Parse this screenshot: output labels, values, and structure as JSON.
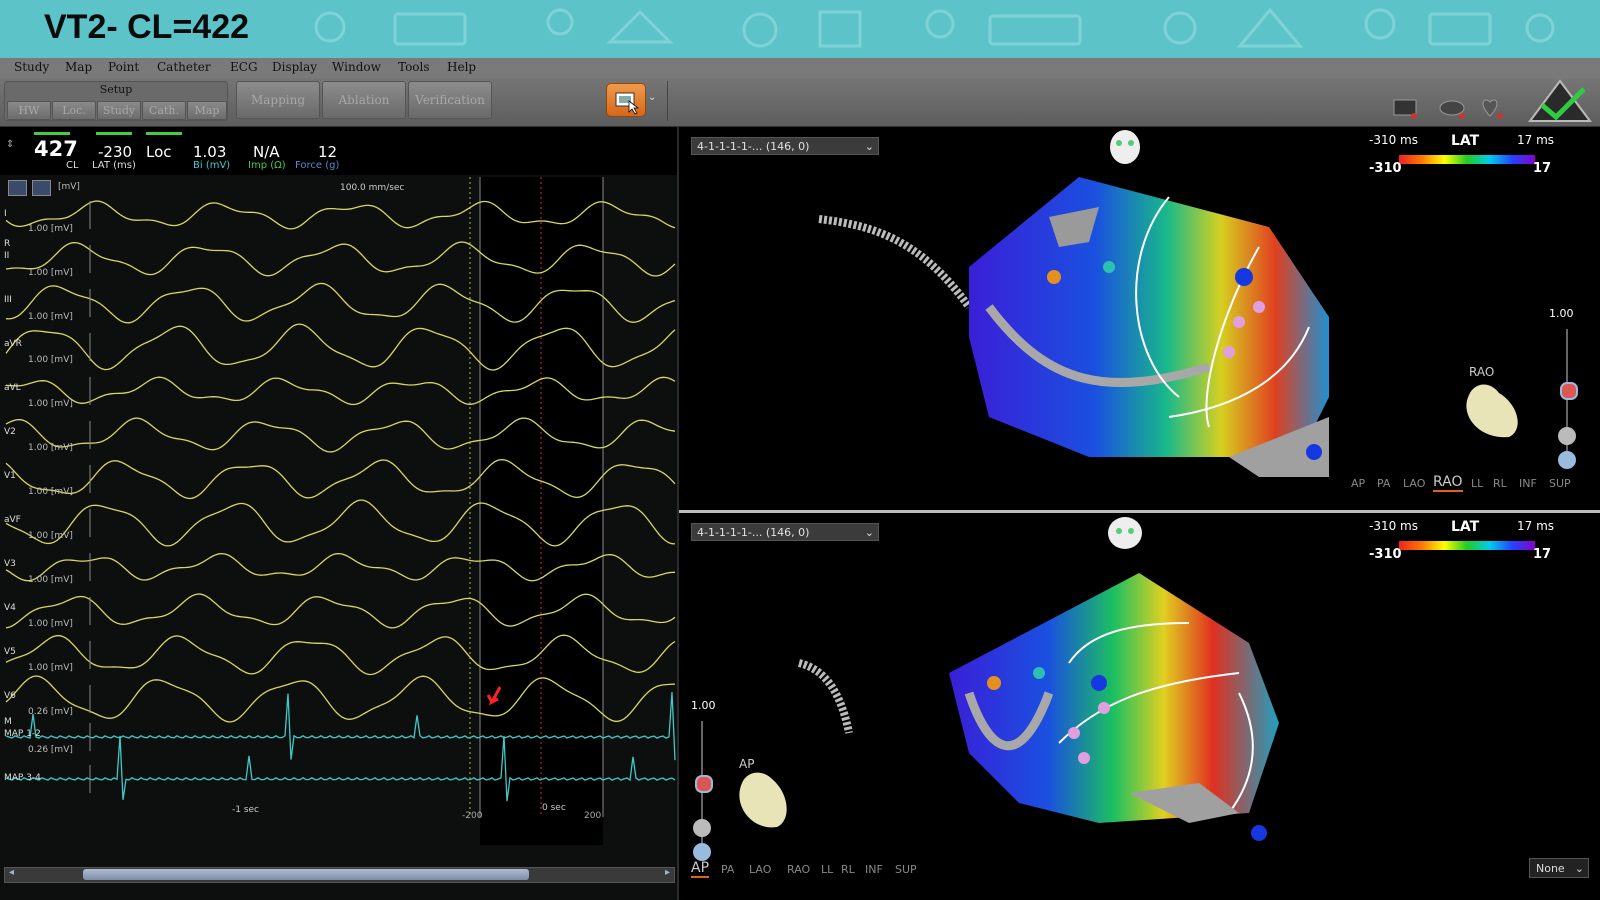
{
  "slide_title": "VT2-  CL=422",
  "menu": [
    "Study",
    "Map",
    "Point",
    "Catheter",
    "ECG",
    "Display",
    "Window",
    "Tools",
    "Help"
  ],
  "setup": {
    "label": "Setup",
    "buttons": [
      "HW",
      "Loc.",
      "Study",
      "Cath.",
      "Map"
    ]
  },
  "workflow": [
    "Mapping",
    "Ablation",
    "Verification"
  ],
  "header": {
    "cl_value": "427",
    "cl_label": "CL",
    "lat_value": "-230",
    "lat_label": "LAT (ms)",
    "loc_value": "Loc",
    "bi_value": "1.03",
    "bi_label": "Bi (mV)",
    "imp_value": "N/A",
    "imp_label": "Imp (Ω)",
    "force_value": "12",
    "force_label": "Force (g)"
  },
  "ecg": {
    "unit": "[mV]",
    "speed": "100.0 mm/sec",
    "leads": [
      "I",
      "II",
      "III",
      "aVR",
      "aVL",
      "V2",
      "V1",
      "aVF",
      "V3",
      "V4",
      "V5",
      "V6",
      "MAP 1-2",
      "MAP 3-4"
    ],
    "extra_lead_letters": [
      "R",
      "M"
    ],
    "ecg_scale": "1.00",
    "map_scale": "0.26",
    "time_labels": [
      "-1 sec",
      "-200",
      "0 sec",
      "200"
    ],
    "trace_color": "#d8d860",
    "map_color": "#3fc9c9"
  },
  "map_top": {
    "selector": "4-1-1-1-1-... (146, 0)",
    "lat_min_top": "-310 ms",
    "lat_title": "LAT",
    "lat_max_top": "17 ms",
    "lat_min": "-310",
    "lat_max": "17",
    "zoom": "1.00",
    "orientation": "RAO",
    "views": [
      "AP",
      "PA",
      "LAO",
      "RAO",
      "LL",
      "RL",
      "INF",
      "SUP"
    ],
    "active_view": "RAO"
  },
  "map_bottom": {
    "selector": "4-1-1-1-1-... (146, 0)",
    "lat_min_top": "-310 ms",
    "lat_title": "LAT",
    "lat_max_top": "17 ms",
    "lat_min": "-310",
    "lat_max": "17",
    "zoom": "1.00",
    "orientation": "AP",
    "views": [
      "AP",
      "PA",
      "LAO",
      "RAO",
      "LL",
      "RL",
      "INF",
      "SUP"
    ],
    "active_view": "AP",
    "dropdown": "None"
  }
}
